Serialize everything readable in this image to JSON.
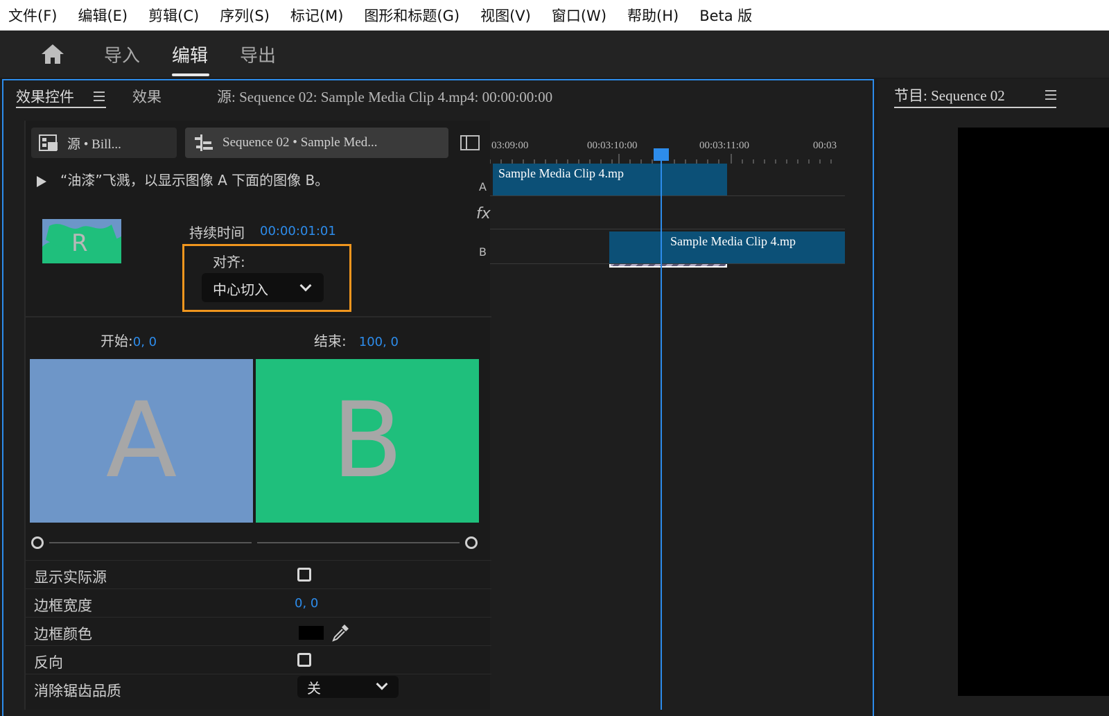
{
  "menubar": {
    "items": [
      "文件(F)",
      "编辑(E)",
      "剪辑(C)",
      "序列(S)",
      "标记(M)",
      "图形和标题(G)",
      "视图(V)",
      "窗口(W)",
      "帮助(H)",
      "Beta 版"
    ]
  },
  "workspace": {
    "tabs": [
      "导入",
      "编辑",
      "导出"
    ],
    "active_tab": "编辑"
  },
  "effect_controls": {
    "tab_active": "效果控件",
    "tab_effects": "效果",
    "source_title": "源: Sequence 02: Sample Media Clip 4.mp4: 00:00:00:00",
    "source_btn_1": "源 • Bill...",
    "source_btn_2": "Sequence 02 • Sample Med...",
    "description": "“油漆”飞溅，以显示图像 A 下面的图像 B。",
    "duration_label": "持续时间",
    "duration_value": "00:00:01:01",
    "align_label": "对齐:",
    "align_value": "中心切入",
    "start_label": "开始:",
    "start_value": "0, 0",
    "end_label": "结束:",
    "end_value": "100, 0",
    "preview_a": "A",
    "preview_b": "B",
    "slider_fraction": 1.0,
    "props": {
      "show_actual_source": "显示实际源",
      "border_width": "边框宽度",
      "border_width_value": "0, 0",
      "border_color": "边框颜色",
      "reverse": "反向",
      "antialias_quality": "消除锯齿品质",
      "antialias_value": "关"
    }
  },
  "timeline": {
    "ruler": [
      "03:09:00",
      "00:03:10:00",
      "00:03:11:00",
      "00:03"
    ],
    "track_a": "A",
    "track_b": "B",
    "fx": "fx",
    "clip_a_label": "Sample Media Clip 4.mp",
    "clip_b_label": "Sample Media Clip 4.mp"
  },
  "program": {
    "title": "节目: Sequence 02"
  },
  "colors": {
    "accent": "#2d8ceb",
    "highlight_box": "#f0961e",
    "preview_a": "#6e96c8",
    "preview_b": "#1fbf7c",
    "clip": "#0c5077"
  }
}
